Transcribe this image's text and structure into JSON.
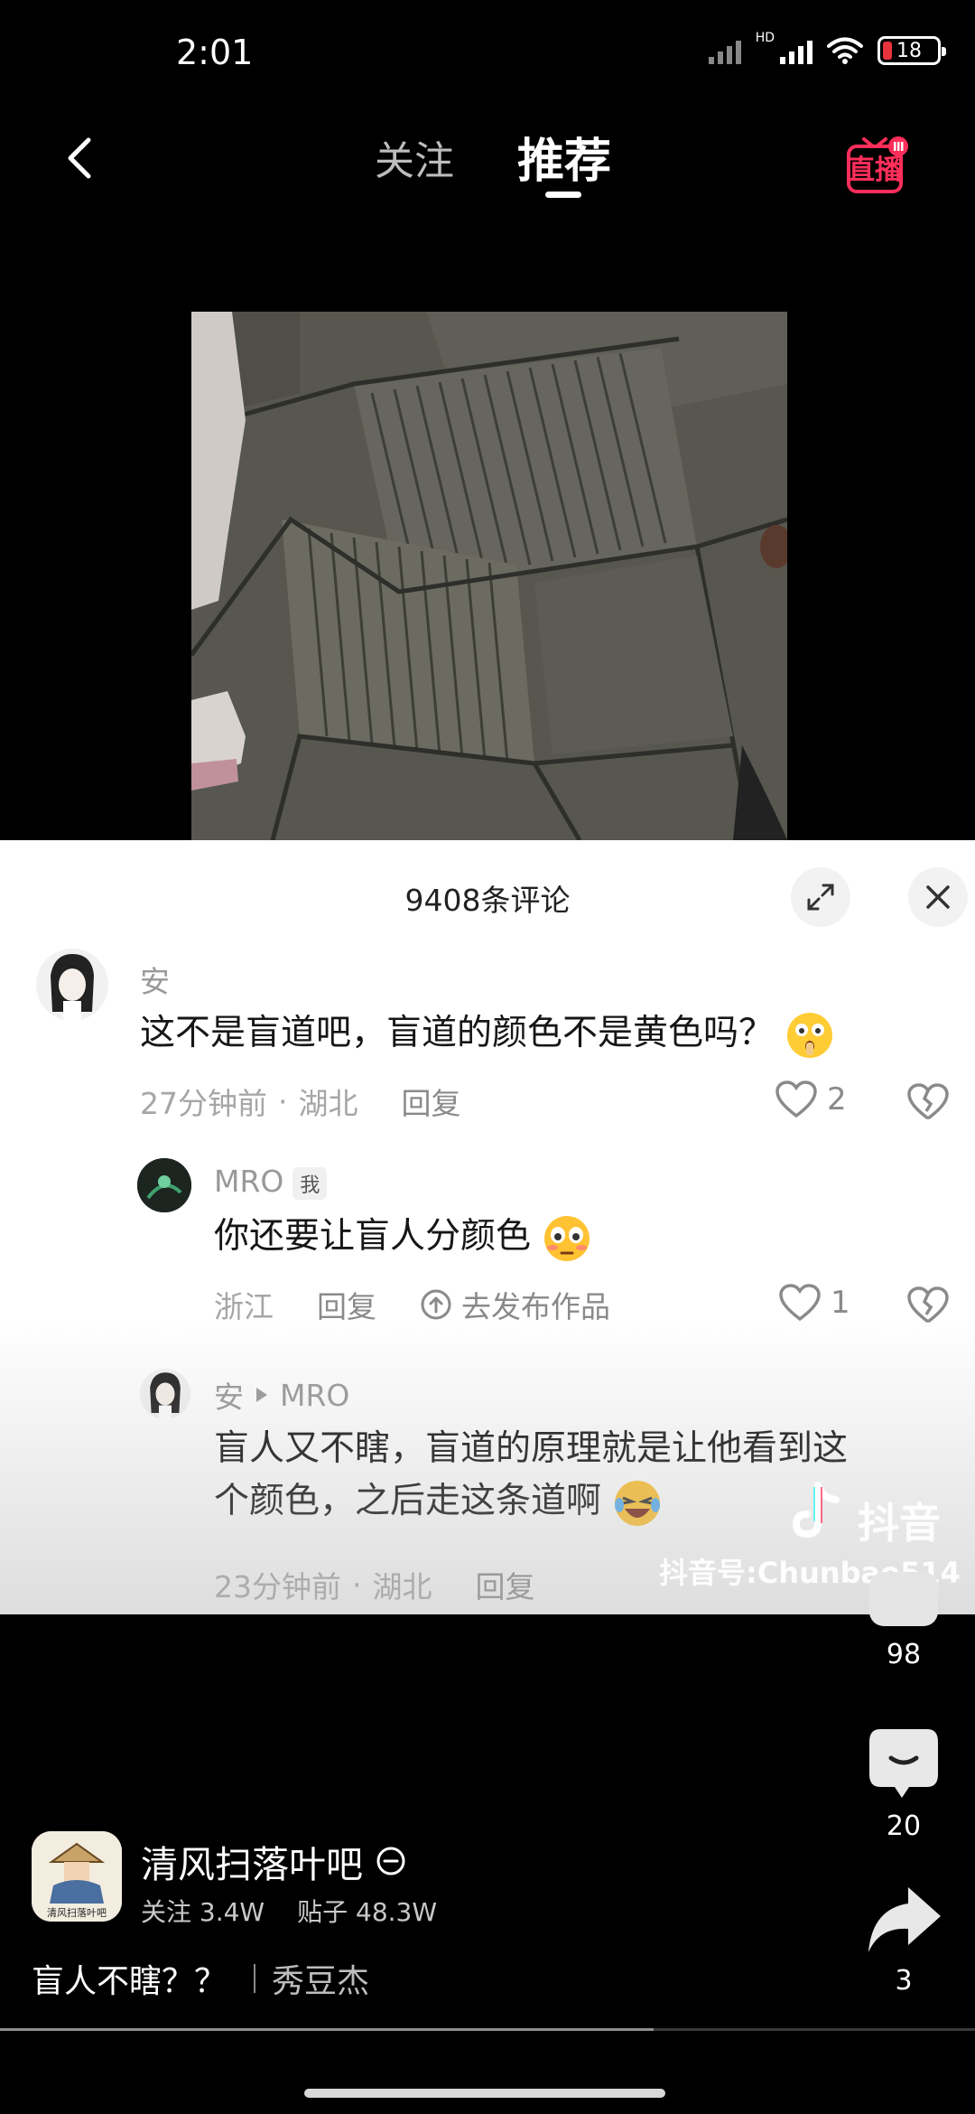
{
  "status_bar": {
    "time": "2:01",
    "network": "HD",
    "battery": "18"
  },
  "top_nav": {
    "tab_follow": "关注",
    "tab_recommend": "推荐",
    "live_label": "直播"
  },
  "comment_panel": {
    "title": "9408条评论",
    "comments": [
      {
        "user": "安",
        "text": "这不是盲道吧，盲道的颜色不是黄色吗？",
        "time": "27分钟前",
        "location": "湖北",
        "reply_label": "回复",
        "likes": "2"
      },
      {
        "user": "MRO",
        "badge": "我",
        "text": "你还要让盲人分颜色",
        "location": "浙江",
        "reply_label": "回复",
        "post_work_label": "去发布作品",
        "likes": "1"
      },
      {
        "user": "安",
        "reply_to": "MRO",
        "text_line1": "盲人又不瞎，盲道的原理就是让他看到这",
        "text_line2": "个颜色，之后走这条道啊",
        "time": "23分钟前",
        "location": "湖北",
        "reply_label": "回复"
      }
    ],
    "watermark_brand": "抖音",
    "watermark_id": "抖音号:Chunbao514"
  },
  "actions": {
    "likes": "98",
    "comments": "20",
    "shares": "3"
  },
  "author": {
    "name": "清风扫落叶吧",
    "avatar_text": "清风扫落叶吧",
    "following": "关注 3.4W",
    "posts": "贴子 48.3W"
  },
  "caption": {
    "text": "盲人不瞎？？",
    "tag": "秀豆杰"
  },
  "video_progress": 0.67,
  "colors": {
    "accent_live": "#ff2e5a",
    "background": "#000000",
    "panel": "#ffffff"
  }
}
